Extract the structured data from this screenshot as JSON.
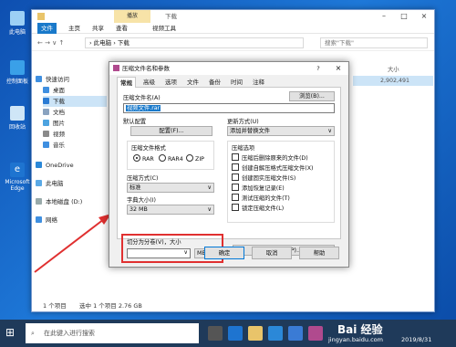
{
  "desktop": {
    "icons": [
      {
        "label": "此电脑"
      },
      {
        "label": "控制面板"
      },
      {
        "label": "回收站"
      },
      {
        "label": "Microsoft Edge"
      }
    ]
  },
  "explorer": {
    "context_tab": "播放",
    "folder_title": "下载",
    "ribbon_tabs": [
      "文件",
      "主页",
      "共享",
      "查看",
      "视频工具"
    ],
    "address": "› 此电脑 › 下载",
    "search_placeholder": "搜索\"下载\"",
    "column_size": "大小",
    "row_size": "2,902,491",
    "nav": [
      "快速访问",
      "桌面",
      "下载",
      "文档",
      "图片",
      "视频",
      "音乐",
      "OneDrive",
      "此电脑",
      "本地磁盘 (D:)",
      "网络"
    ],
    "status_left": "1 个项目",
    "status_selected": "选中 1 个项目  2.76 GB"
  },
  "dialog": {
    "title": "压缩文件名和参数",
    "help_btn": "?",
    "close_btn": "×",
    "tabs": [
      "常规",
      "高级",
      "选项",
      "文件",
      "备份",
      "时间",
      "注释"
    ],
    "archive_name_label": "压缩文件名(A)",
    "archive_name_value": "视频文件.rar",
    "browse_btn": "浏览(B)...",
    "default_config_label": "默认配置",
    "config_btn": "配置(F)...",
    "update_mode_label": "更新方式(U)",
    "update_mode_value": "添加并替换文件",
    "format_label": "压缩文件格式",
    "formats": [
      "RAR",
      "RAR4",
      "ZIP"
    ],
    "selected_format": "RAR",
    "method_label": "压缩方式(C)",
    "method_value": "标准",
    "dict_label": "字典大小(I)",
    "dict_value": "32 MB",
    "options_label": "压缩选项",
    "options": [
      "压缩后删除原来的文件(D)",
      "创建自解压格式压缩文件(X)",
      "创建固实压缩文件(S)",
      "添加恢复记录(E)",
      "测试压缩的文件(T)",
      "锁定压缩文件(L)"
    ],
    "split_label": "切分为分卷(V)，大小",
    "split_unit": "MB",
    "password_btn": "设置密码(P)...",
    "ok_btn": "确定",
    "cancel_btn": "取消",
    "help2_btn": "帮助"
  },
  "taskbar": {
    "search_placeholder": "在此键入进行搜索",
    "date": "2019/8/31"
  },
  "watermark": {
    "brand": "Bai 经验",
    "site": "jingyan.baidu.com"
  },
  "colors": {
    "annotation": "#e03030",
    "accent": "#1979ca",
    "desktop": "#1566c4"
  }
}
